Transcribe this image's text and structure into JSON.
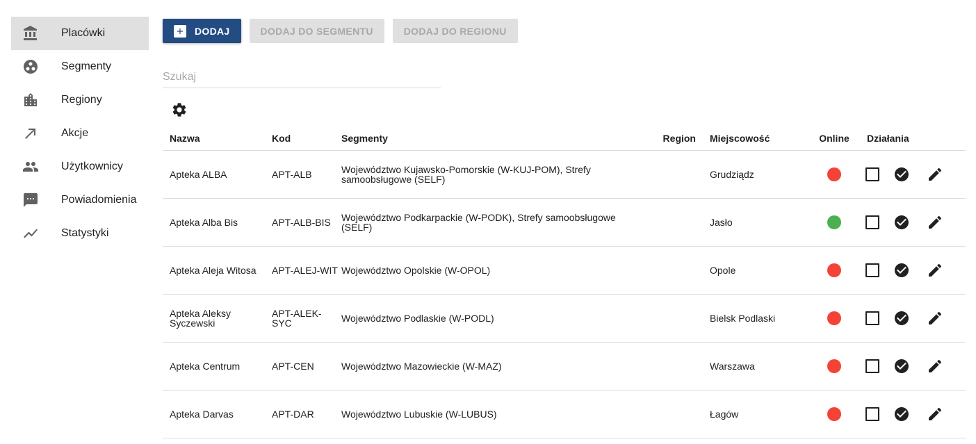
{
  "sidebar": {
    "items": [
      {
        "label": "Placówki",
        "icon": "bank-icon",
        "active": true
      },
      {
        "label": "Segmenty",
        "icon": "segments-icon",
        "active": false
      },
      {
        "label": "Regiony",
        "icon": "city-icon",
        "active": false
      },
      {
        "label": "Akcje",
        "icon": "arrow-up-right-icon",
        "active": false
      },
      {
        "label": "Użytkownicy",
        "icon": "people-icon",
        "active": false
      },
      {
        "label": "Powiadomienia",
        "icon": "chat-icon",
        "active": false
      },
      {
        "label": "Statystyki",
        "icon": "trending-up-icon",
        "active": false
      }
    ]
  },
  "toolbar": {
    "add_label": "DODAJ",
    "add_to_segment_label": "DODAJ DO SEGMENTU",
    "add_to_region_label": "DODAJ DO REGIONU"
  },
  "search": {
    "placeholder": "Szukaj",
    "value": ""
  },
  "table": {
    "columns": {
      "name": "Nazwa",
      "code": "Kod",
      "segments": "Segmenty",
      "region": "Region",
      "city": "Miejscowość",
      "online": "Online",
      "actions": "Działania"
    },
    "rows": [
      {
        "name": "Apteka ALBA",
        "code": "APT-ALB",
        "segments": "Województwo Kujawsko-Pomorskie (W-KUJ-POM), Strefy samoobsługowe (SELF)",
        "region": "",
        "city": "Grudziądz",
        "online": false
      },
      {
        "name": "Apteka Alba Bis",
        "code": "APT-ALB-BIS",
        "segments": "Województwo Podkarpackie (W-PODK), Strefy samoobsługowe (SELF)",
        "region": "",
        "city": "Jasło",
        "online": true
      },
      {
        "name": "Apteka Aleja Witosa",
        "code": "APT-ALEJ-WIT",
        "segments": "Województwo Opolskie (W-OPOL)",
        "region": "",
        "city": "Opole",
        "online": false
      },
      {
        "name": "Apteka Aleksy Syczewski",
        "code": "APT-ALEK-SYC",
        "segments": "Województwo Podlaskie (W-PODL)",
        "region": "",
        "city": "Bielsk Podlaski",
        "online": false
      },
      {
        "name": "Apteka Centrum",
        "code": "APT-CEN",
        "segments": "Województwo Mazowieckie (W-MAZ)",
        "region": "",
        "city": "Warszawa",
        "online": false
      },
      {
        "name": "Apteka Darvas",
        "code": "APT-DAR",
        "segments": "Województwo Lubuskie (W-LUBUS)",
        "region": "",
        "city": "Łagów",
        "online": false
      }
    ]
  },
  "colors": {
    "primary": "#234c82",
    "online": "#4caf50",
    "offline": "#f44336",
    "active_nav_bg": "#e0e0e0"
  }
}
